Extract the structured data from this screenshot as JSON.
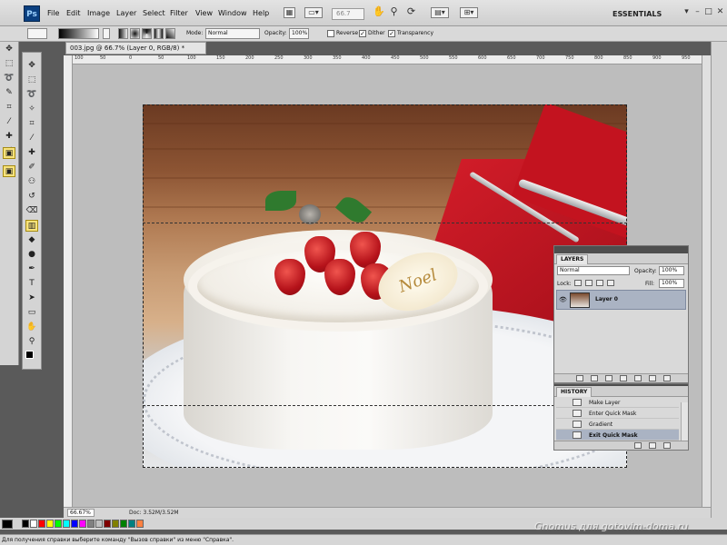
{
  "menubar": {
    "logo": "Ps",
    "items": [
      "File",
      "Edit",
      "Image",
      "Layer",
      "Select",
      "Filter",
      "View",
      "Window",
      "Help"
    ],
    "zoom": "66.7",
    "workspace": "ESSENTIALS"
  },
  "options": {
    "mode_label": "Mode:",
    "mode_value": "Normal",
    "opacity_label": "Opacity:",
    "opacity_value": "100%",
    "reverse_label": "Reverse",
    "dither_label": "Dither",
    "transparency_label": "Transparency",
    "reverse_checked": false,
    "dither_checked": true,
    "transparency_checked": true
  },
  "document": {
    "tab_title": "003.jpg @ 66.7% (Layer 0, RGB/8) *",
    "ruler_ticks": [
      "100",
      "50",
      "0",
      "50",
      "100",
      "150",
      "200",
      "250",
      "300",
      "350",
      "400",
      "450",
      "500",
      "550",
      "600",
      "650",
      "700",
      "750",
      "800",
      "850",
      "900",
      "950"
    ],
    "zoom_pct": "66.67%",
    "doc_size": "Doc: 3.52M/3.52M",
    "plaque_text": "Noel"
  },
  "layers": {
    "tab": "LAYERS",
    "blend_mode": "Normal",
    "opacity_label": "Opacity:",
    "opacity_value": "100%",
    "lock_label": "Lock:",
    "fill_label": "Fill:",
    "fill_value": "100%",
    "layer_name": "Layer 0"
  },
  "history": {
    "tab": "HISTORY",
    "items": [
      "Make Layer",
      "Enter Quick Mask",
      "Gradient",
      "Exit Quick Mask"
    ]
  },
  "footer": {
    "watermark": "Gnomus для gotovim-doma.ru",
    "status": "Для получения справки выберите команду \"Вызов справки\" из меню \"Справка\"."
  },
  "colors": {
    "swatches": [
      "#000000",
      "#ffffff",
      "#ff0000",
      "#ffff00",
      "#00ff00",
      "#00ffff",
      "#0000ff",
      "#ff00ff",
      "#808080",
      "#c0c0c0",
      "#800000",
      "#808000",
      "#008000",
      "#008080",
      "#000080",
      "#800080",
      "#ff8040"
    ]
  }
}
